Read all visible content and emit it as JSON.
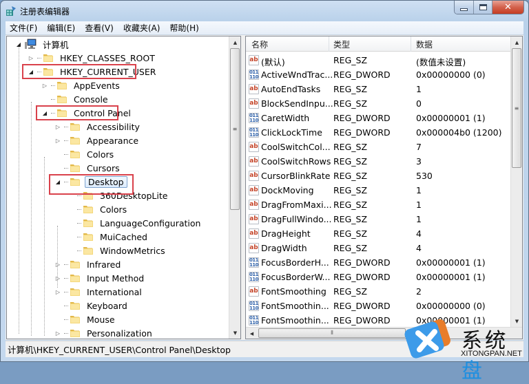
{
  "window": {
    "title": "注册表编辑器",
    "buttons": {
      "minimize": "minimize",
      "maximize": "maximize",
      "close": "close"
    }
  },
  "menu": [
    {
      "label": "文件(F)"
    },
    {
      "label": "编辑(E)"
    },
    {
      "label": "查看(V)"
    },
    {
      "label": "收藏夹(A)"
    },
    {
      "label": "帮助(H)"
    }
  ],
  "tree": {
    "root": "计算机",
    "items": [
      {
        "label": "HKEY_CLASSES_ROOT",
        "level": 1,
        "expander": "collapsed",
        "highlighted": false
      },
      {
        "label": "HKEY_CURRENT_USER",
        "level": 1,
        "expander": "expanded",
        "highlighted": true
      },
      {
        "label": "AppEvents",
        "level": 2,
        "expander": "collapsed",
        "highlighted": false
      },
      {
        "label": "Console",
        "level": 2,
        "expander": "none",
        "highlighted": false
      },
      {
        "label": "Control Panel",
        "level": 2,
        "expander": "expanded",
        "highlighted": true
      },
      {
        "label": "Accessibility",
        "level": 3,
        "expander": "collapsed",
        "highlighted": false
      },
      {
        "label": "Appearance",
        "level": 3,
        "expander": "collapsed",
        "highlighted": false
      },
      {
        "label": "Colors",
        "level": 3,
        "expander": "none",
        "highlighted": false
      },
      {
        "label": "Cursors",
        "level": 3,
        "expander": "none",
        "highlighted": false
      },
      {
        "label": "Desktop",
        "level": 3,
        "expander": "expanded",
        "highlighted": true,
        "selected": true
      },
      {
        "label": "360DesktopLite",
        "level": 4,
        "expander": "none",
        "highlighted": false
      },
      {
        "label": "Colors",
        "level": 4,
        "expander": "none",
        "highlighted": false
      },
      {
        "label": "LanguageConfiguration",
        "level": 4,
        "expander": "none",
        "highlighted": false
      },
      {
        "label": "MuiCached",
        "level": 4,
        "expander": "none",
        "highlighted": false
      },
      {
        "label": "WindowMetrics",
        "level": 4,
        "expander": "none",
        "highlighted": false
      },
      {
        "label": "Infrared",
        "level": 3,
        "expander": "collapsed",
        "highlighted": false
      },
      {
        "label": "Input Method",
        "level": 3,
        "expander": "collapsed",
        "highlighted": false
      },
      {
        "label": "International",
        "level": 3,
        "expander": "collapsed",
        "highlighted": false
      },
      {
        "label": "Keyboard",
        "level": 3,
        "expander": "none",
        "highlighted": false
      },
      {
        "label": "Mouse",
        "level": 3,
        "expander": "none",
        "highlighted": false
      },
      {
        "label": "Personalization",
        "level": 3,
        "expander": "collapsed",
        "highlighted": false
      }
    ]
  },
  "list": {
    "columns": [
      "名称",
      "类型",
      "数据"
    ],
    "rows": [
      {
        "name": "(默认)",
        "type": "REG_SZ",
        "data": "(数值未设置)",
        "icon": "sz"
      },
      {
        "name": "ActiveWndTrac...",
        "type": "REG_DWORD",
        "data": "0x00000000 (0)",
        "icon": "dw"
      },
      {
        "name": "AutoEndTasks",
        "type": "REG_SZ",
        "data": "1",
        "icon": "sz"
      },
      {
        "name": "BlockSendInpu...",
        "type": "REG_SZ",
        "data": "0",
        "icon": "sz"
      },
      {
        "name": "CaretWidth",
        "type": "REG_DWORD",
        "data": "0x00000001 (1)",
        "icon": "dw"
      },
      {
        "name": "ClickLockTime",
        "type": "REG_DWORD",
        "data": "0x000004b0 (1200)",
        "icon": "dw"
      },
      {
        "name": "CoolSwitchCol...",
        "type": "REG_SZ",
        "data": "7",
        "icon": "sz"
      },
      {
        "name": "CoolSwitchRows",
        "type": "REG_SZ",
        "data": "3",
        "icon": "sz"
      },
      {
        "name": "CursorBlinkRate",
        "type": "REG_SZ",
        "data": "530",
        "icon": "sz"
      },
      {
        "name": "DockMoving",
        "type": "REG_SZ",
        "data": "1",
        "icon": "sz"
      },
      {
        "name": "DragFromMaxi...",
        "type": "REG_SZ",
        "data": "1",
        "icon": "sz"
      },
      {
        "name": "DragFullWindo...",
        "type": "REG_SZ",
        "data": "1",
        "icon": "sz"
      },
      {
        "name": "DragHeight",
        "type": "REG_SZ",
        "data": "4",
        "icon": "sz"
      },
      {
        "name": "DragWidth",
        "type": "REG_SZ",
        "data": "4",
        "icon": "sz"
      },
      {
        "name": "FocusBorderH...",
        "type": "REG_DWORD",
        "data": "0x00000001 (1)",
        "icon": "dw"
      },
      {
        "name": "FocusBorderW...",
        "type": "REG_DWORD",
        "data": "0x00000001 (1)",
        "icon": "dw"
      },
      {
        "name": "FontSmoothing",
        "type": "REG_SZ",
        "data": "2",
        "icon": "sz"
      },
      {
        "name": "FontSmoothin...",
        "type": "REG_DWORD",
        "data": "0x00000000 (0)",
        "icon": "dw"
      },
      {
        "name": "FontSmoothin...",
        "type": "REG_DWORD",
        "data": "0x00000001 (1)",
        "icon": "dw"
      }
    ]
  },
  "icons": {
    "sz": "ab",
    "dw": "011\n110"
  },
  "statusbar": {
    "path": "计算机\\HKEY_CURRENT_USER\\Control Panel\\Desktop"
  },
  "watermark": {
    "brand_a": "系统",
    "brand_b": "盘",
    "sub": "XITONGPAN.NET"
  },
  "colors": {
    "highlight_box": "#d9414b",
    "sz_icon": "#c4452a",
    "dword_icon": "#2a5ea8"
  }
}
